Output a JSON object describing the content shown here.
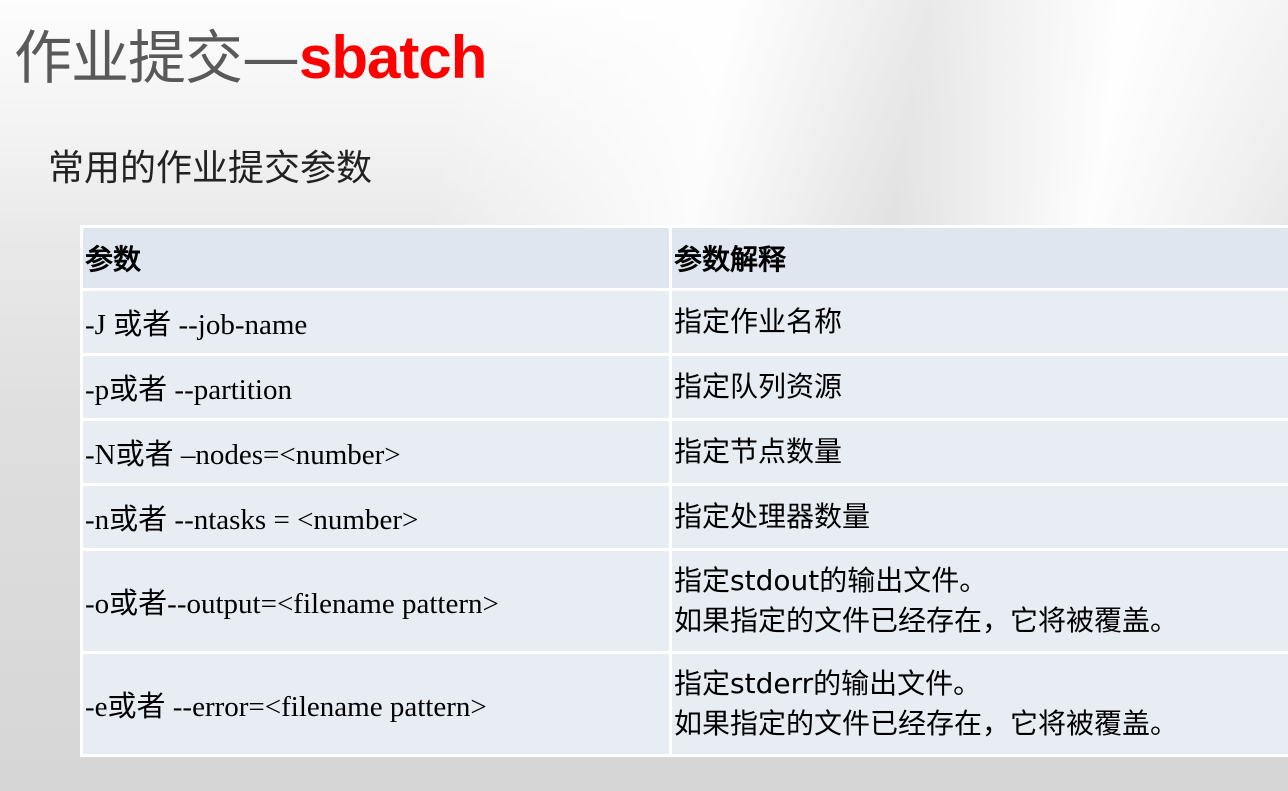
{
  "slide": {
    "title_zh": "作业提交—",
    "title_cmd": "sbatch",
    "subtitle": "常用的作业提交参数"
  },
  "table": {
    "headers": [
      "参数",
      "参数解释"
    ],
    "rows": [
      {
        "param": "-J 或者 --job-name",
        "desc": "指定作业名称"
      },
      {
        "param": "-p或者 --partition",
        "desc": "指定队列资源"
      },
      {
        "param": "-N或者 –nodes=<number>",
        "desc": "指定节点数量"
      },
      {
        "param": "-n或者 --ntasks = <number>",
        "desc": "指定处理器数量"
      },
      {
        "param": "-o或者--output=<filename pattern>",
        "desc": "指定stdout的输出文件。\n如果指定的文件已经存在，它将被覆盖。"
      },
      {
        "param": "-e或者 --error=<filename pattern>",
        "desc": "指定stderr的输出文件。\n如果指定的文件已经存在，它将被覆盖。"
      }
    ]
  },
  "colors": {
    "title_text": "#595959",
    "command_accent": "#ff0000",
    "table_cell_bg": "#e8edf4",
    "table_border": "#ffffff"
  }
}
